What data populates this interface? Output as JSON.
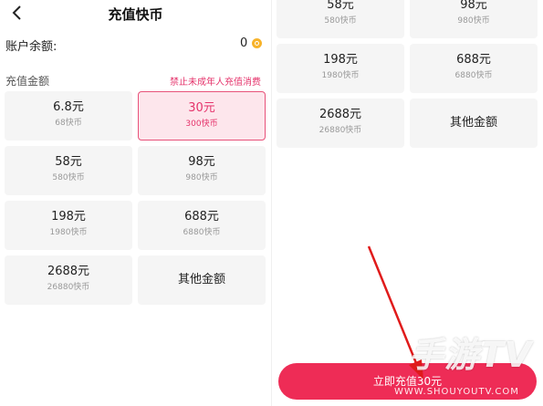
{
  "header": {
    "title": "充值快币"
  },
  "balance": {
    "label": "账户余额:",
    "value": "0"
  },
  "recharge": {
    "label": "充值金额",
    "notice": "禁止未成年人充值消费",
    "options": [
      {
        "amount": "6.8元",
        "coins": "68快币"
      },
      {
        "amount": "30元",
        "coins": "300快币"
      },
      {
        "amount": "58元",
        "coins": "580快币"
      },
      {
        "amount": "98元",
        "coins": "980快币"
      },
      {
        "amount": "198元",
        "coins": "1980快币"
      },
      {
        "amount": "688元",
        "coins": "6880快币"
      },
      {
        "amount": "2688元",
        "coins": "26880快币"
      },
      {
        "amount": "其他金额"
      }
    ]
  },
  "pay_button": {
    "label": "立即充值30元"
  },
  "watermark": {
    "brand": "手游TV",
    "url": "WWW.SHOUYOUTV.COM"
  },
  "colors": {
    "accent": "#ee2c56",
    "selected_bg": "#fde6ec",
    "card_bg": "#f5f5f5",
    "coin": "#f7b32b"
  },
  "icons": {
    "back": "chevron-left-icon",
    "coin": "coin-icon"
  }
}
